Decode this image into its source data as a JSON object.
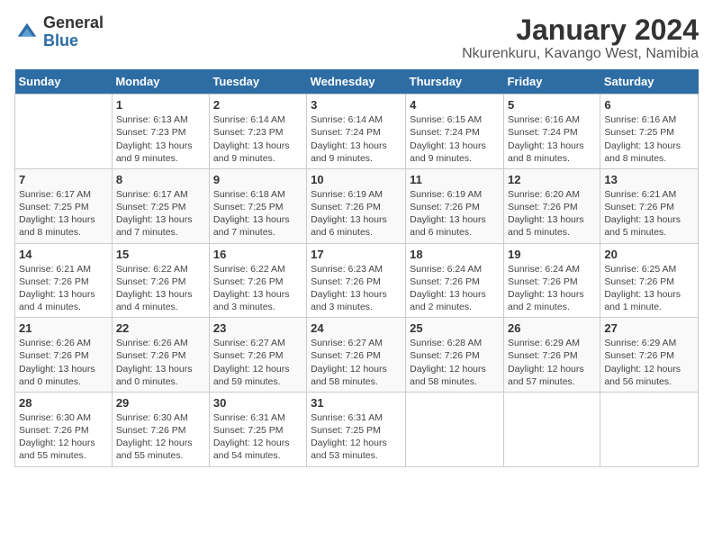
{
  "header": {
    "logo": {
      "line1": "General",
      "line2": "Blue"
    },
    "title": "January 2024",
    "subtitle": "Nkurenkuru, Kavango West, Namibia"
  },
  "weekdays": [
    "Sunday",
    "Monday",
    "Tuesday",
    "Wednesday",
    "Thursday",
    "Friday",
    "Saturday"
  ],
  "weeks": [
    [
      {
        "day": "",
        "info": ""
      },
      {
        "day": "1",
        "info": "Sunrise: 6:13 AM\nSunset: 7:23 PM\nDaylight: 13 hours and 9 minutes."
      },
      {
        "day": "2",
        "info": "Sunrise: 6:14 AM\nSunset: 7:23 PM\nDaylight: 13 hours and 9 minutes."
      },
      {
        "day": "3",
        "info": "Sunrise: 6:14 AM\nSunset: 7:24 PM\nDaylight: 13 hours and 9 minutes."
      },
      {
        "day": "4",
        "info": "Sunrise: 6:15 AM\nSunset: 7:24 PM\nDaylight: 13 hours and 9 minutes."
      },
      {
        "day": "5",
        "info": "Sunrise: 6:16 AM\nSunset: 7:24 PM\nDaylight: 13 hours and 8 minutes."
      },
      {
        "day": "6",
        "info": "Sunrise: 6:16 AM\nSunset: 7:25 PM\nDaylight: 13 hours and 8 minutes."
      }
    ],
    [
      {
        "day": "7",
        "info": "Sunrise: 6:17 AM\nSunset: 7:25 PM\nDaylight: 13 hours and 8 minutes."
      },
      {
        "day": "8",
        "info": "Sunrise: 6:17 AM\nSunset: 7:25 PM\nDaylight: 13 hours and 7 minutes."
      },
      {
        "day": "9",
        "info": "Sunrise: 6:18 AM\nSunset: 7:25 PM\nDaylight: 13 hours and 7 minutes."
      },
      {
        "day": "10",
        "info": "Sunrise: 6:19 AM\nSunset: 7:26 PM\nDaylight: 13 hours and 6 minutes."
      },
      {
        "day": "11",
        "info": "Sunrise: 6:19 AM\nSunset: 7:26 PM\nDaylight: 13 hours and 6 minutes."
      },
      {
        "day": "12",
        "info": "Sunrise: 6:20 AM\nSunset: 7:26 PM\nDaylight: 13 hours and 5 minutes."
      },
      {
        "day": "13",
        "info": "Sunrise: 6:21 AM\nSunset: 7:26 PM\nDaylight: 13 hours and 5 minutes."
      }
    ],
    [
      {
        "day": "14",
        "info": "Sunrise: 6:21 AM\nSunset: 7:26 PM\nDaylight: 13 hours and 4 minutes."
      },
      {
        "day": "15",
        "info": "Sunrise: 6:22 AM\nSunset: 7:26 PM\nDaylight: 13 hours and 4 minutes."
      },
      {
        "day": "16",
        "info": "Sunrise: 6:22 AM\nSunset: 7:26 PM\nDaylight: 13 hours and 3 minutes."
      },
      {
        "day": "17",
        "info": "Sunrise: 6:23 AM\nSunset: 7:26 PM\nDaylight: 13 hours and 3 minutes."
      },
      {
        "day": "18",
        "info": "Sunrise: 6:24 AM\nSunset: 7:26 PM\nDaylight: 13 hours and 2 minutes."
      },
      {
        "day": "19",
        "info": "Sunrise: 6:24 AM\nSunset: 7:26 PM\nDaylight: 13 hours and 2 minutes."
      },
      {
        "day": "20",
        "info": "Sunrise: 6:25 AM\nSunset: 7:26 PM\nDaylight: 13 hours and 1 minute."
      }
    ],
    [
      {
        "day": "21",
        "info": "Sunrise: 6:26 AM\nSunset: 7:26 PM\nDaylight: 13 hours and 0 minutes."
      },
      {
        "day": "22",
        "info": "Sunrise: 6:26 AM\nSunset: 7:26 PM\nDaylight: 13 hours and 0 minutes."
      },
      {
        "day": "23",
        "info": "Sunrise: 6:27 AM\nSunset: 7:26 PM\nDaylight: 12 hours and 59 minutes."
      },
      {
        "day": "24",
        "info": "Sunrise: 6:27 AM\nSunset: 7:26 PM\nDaylight: 12 hours and 58 minutes."
      },
      {
        "day": "25",
        "info": "Sunrise: 6:28 AM\nSunset: 7:26 PM\nDaylight: 12 hours and 58 minutes."
      },
      {
        "day": "26",
        "info": "Sunrise: 6:29 AM\nSunset: 7:26 PM\nDaylight: 12 hours and 57 minutes."
      },
      {
        "day": "27",
        "info": "Sunrise: 6:29 AM\nSunset: 7:26 PM\nDaylight: 12 hours and 56 minutes."
      }
    ],
    [
      {
        "day": "28",
        "info": "Sunrise: 6:30 AM\nSunset: 7:26 PM\nDaylight: 12 hours and 55 minutes."
      },
      {
        "day": "29",
        "info": "Sunrise: 6:30 AM\nSunset: 7:26 PM\nDaylight: 12 hours and 55 minutes."
      },
      {
        "day": "30",
        "info": "Sunrise: 6:31 AM\nSunset: 7:25 PM\nDaylight: 12 hours and 54 minutes."
      },
      {
        "day": "31",
        "info": "Sunrise: 6:31 AM\nSunset: 7:25 PM\nDaylight: 12 hours and 53 minutes."
      },
      {
        "day": "",
        "info": ""
      },
      {
        "day": "",
        "info": ""
      },
      {
        "day": "",
        "info": ""
      }
    ]
  ]
}
